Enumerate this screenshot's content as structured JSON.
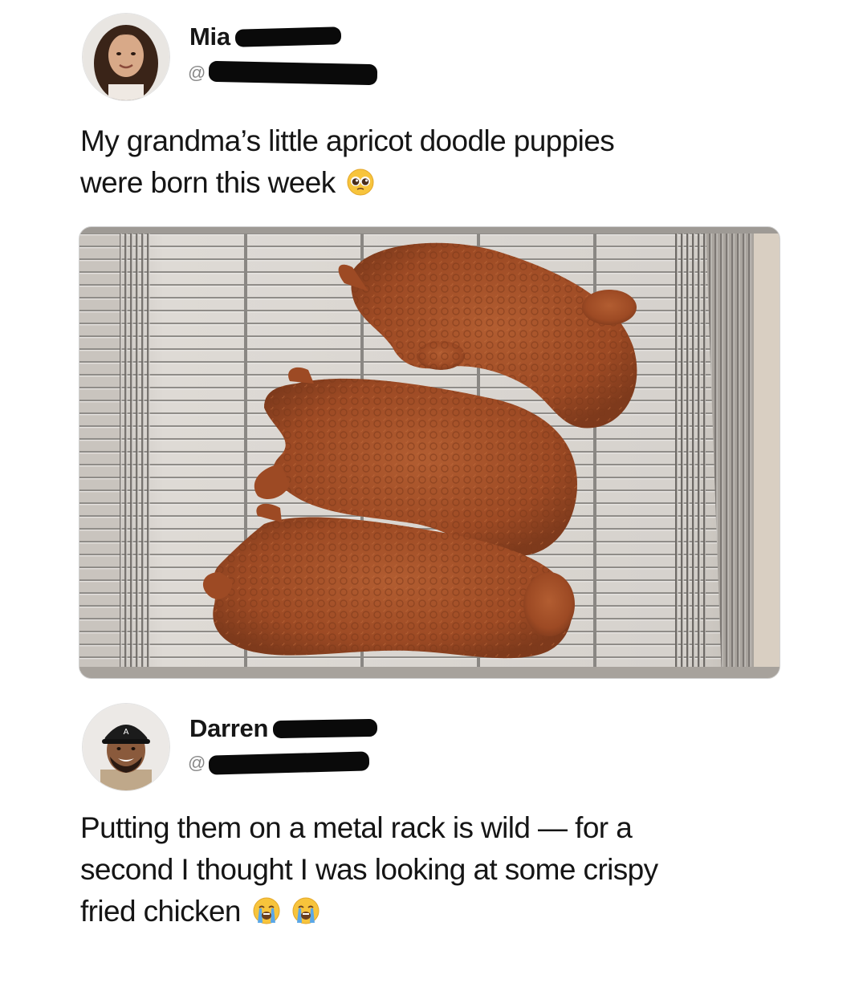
{
  "posts": [
    {
      "author_name": "Mia",
      "handle_prefix": "@",
      "text_line1": "My grandma’s little apricot doodle puppies",
      "text_line2": "were born this week",
      "emoji": "pleading-face-icon",
      "media": {
        "icon": "photo-puppies-on-rack"
      }
    },
    {
      "author_name": "Darren",
      "handle_prefix": "@",
      "text_line1": "Putting them on a metal rack is wild — for a",
      "text_line2": "second I thought I was looking at some crispy",
      "text_line3": "fried chicken",
      "emojis": [
        "loudly-crying-face-icon",
        "loudly-crying-face-icon"
      ]
    }
  ],
  "colors": {
    "background": "#ffffff",
    "text": "#151515",
    "redaction": "#0a0a0a",
    "puppy_fur": "#a4502a",
    "rack_tray": "#d7d3ce"
  }
}
